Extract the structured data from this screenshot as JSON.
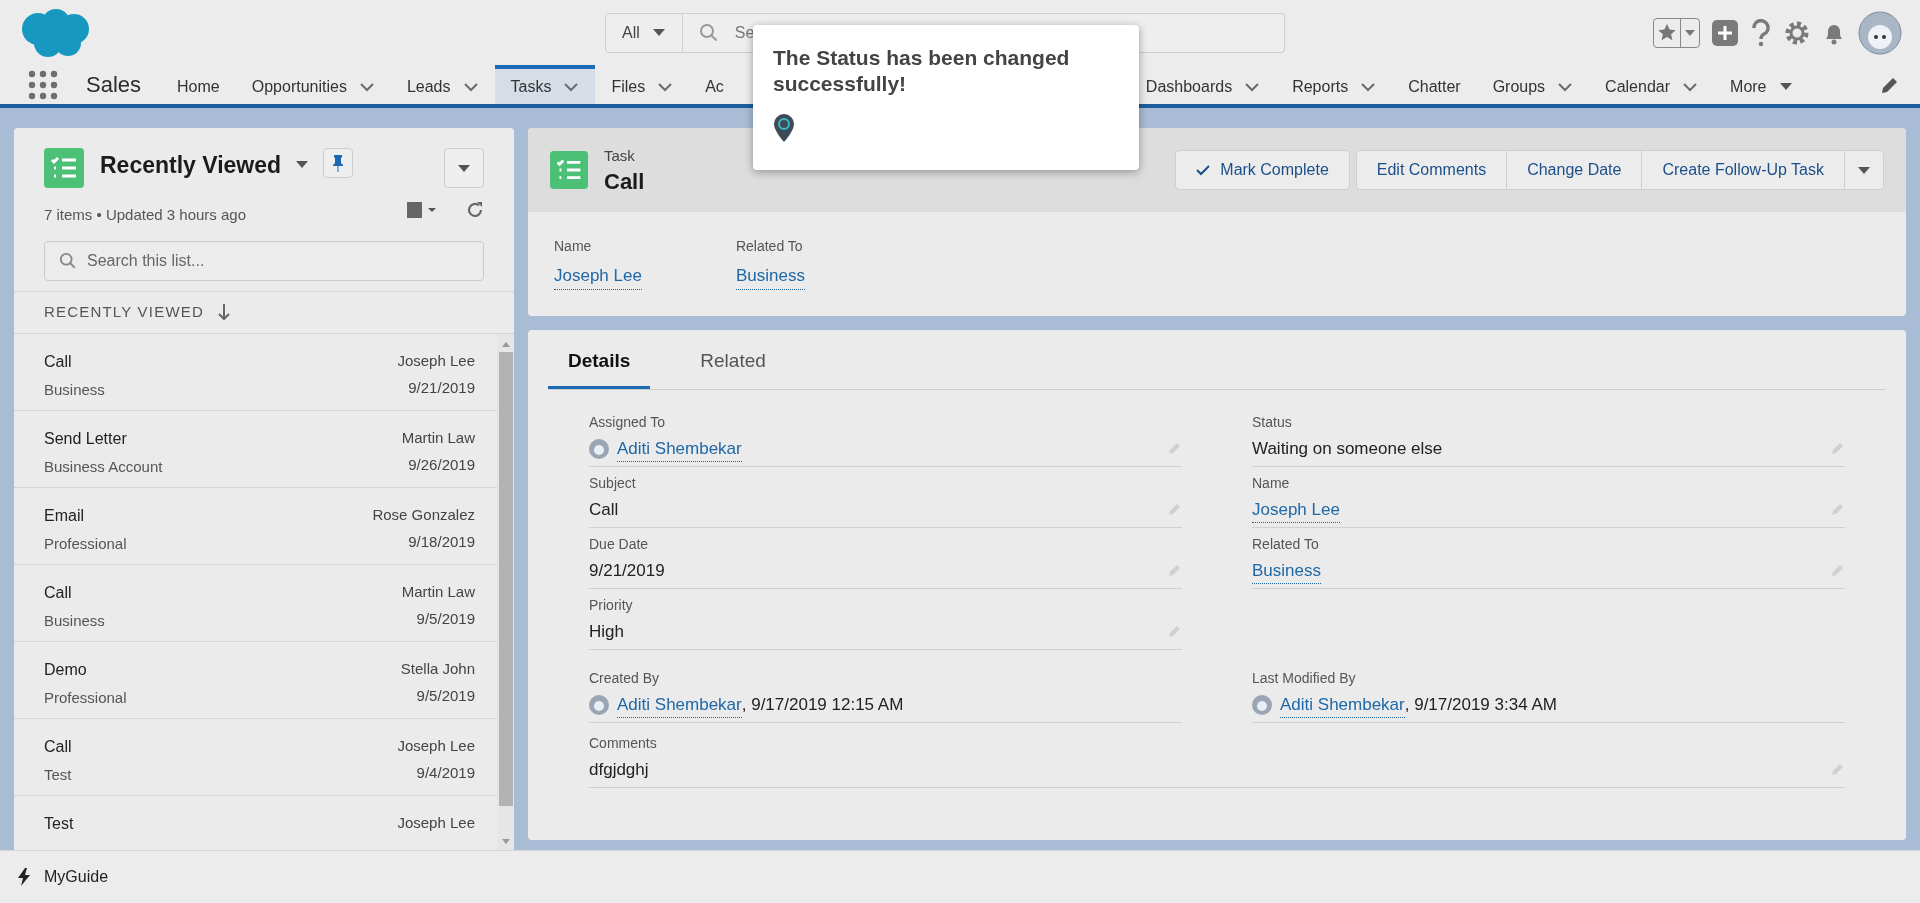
{
  "header": {
    "search_scope": "All",
    "search_placeholder": "Se"
  },
  "nav": {
    "app_name": "Sales",
    "items": [
      {
        "label": "Home",
        "kind": "plain",
        "selected": false
      },
      {
        "label": "Opportunities",
        "kind": "menu",
        "selected": false
      },
      {
        "label": "Leads",
        "kind": "menu",
        "selected": false
      },
      {
        "label": "Tasks",
        "kind": "menu",
        "selected": true
      },
      {
        "label": "Files",
        "kind": "menu",
        "selected": false
      },
      {
        "label": "Ac",
        "kind": "plain",
        "selected": false
      },
      {
        "label": "Dashboards",
        "kind": "menu",
        "selected": false
      },
      {
        "label": "Reports",
        "kind": "menu",
        "selected": false
      },
      {
        "label": "Chatter",
        "kind": "plain",
        "selected": false
      },
      {
        "label": "Groups",
        "kind": "menu",
        "selected": false
      },
      {
        "label": "Calendar",
        "kind": "menu",
        "selected": false
      },
      {
        "label": "More",
        "kind": "more",
        "selected": false
      }
    ]
  },
  "toast": {
    "message": "The Status has been changed successfully!"
  },
  "list": {
    "title": "Recently Viewed",
    "meta": "7 items • Updated 3 hours ago",
    "search_placeholder": "Search this list...",
    "column": "RECENTLY VIEWED",
    "rows": [
      {
        "title": "Call",
        "subtitle": "Business",
        "owner": "Joseph Lee",
        "date": "9/21/2019"
      },
      {
        "title": "Send Letter",
        "subtitle": "Business Account",
        "owner": "Martin Law",
        "date": "9/26/2019"
      },
      {
        "title": "Email",
        "subtitle": "Professional",
        "owner": "Rose Gonzalez",
        "date": "9/18/2019"
      },
      {
        "title": "Call",
        "subtitle": "Business",
        "owner": "Martin Law",
        "date": "9/5/2019"
      },
      {
        "title": "Demo",
        "subtitle": "Professional",
        "owner": "Stella John",
        "date": "9/5/2019"
      },
      {
        "title": "Call",
        "subtitle": "Test",
        "owner": "Joseph Lee",
        "date": "9/4/2019"
      },
      {
        "title": "Test",
        "owner": "Joseph Lee"
      }
    ]
  },
  "record": {
    "object_label": "Task",
    "title": "Call",
    "actions": [
      {
        "label": "Mark Complete",
        "kind": "check"
      },
      {
        "label": "Edit Comments",
        "kind": "plain"
      },
      {
        "label": "Change Date",
        "kind": "plain"
      },
      {
        "label": "Create Follow-Up Task",
        "kind": "plain"
      }
    ],
    "highlights": [
      {
        "label": "Name",
        "value": "Joseph Lee"
      },
      {
        "label": "Related To",
        "value": "Business"
      }
    ],
    "tabs": [
      {
        "label": "Details",
        "selected": true
      },
      {
        "label": "Related",
        "selected": false
      }
    ],
    "fields_left": [
      {
        "label": "Assigned To",
        "kind": "user",
        "value": "Aditi Shembekar"
      },
      {
        "label": "Subject",
        "kind": "text",
        "value": "Call"
      },
      {
        "label": "Due Date",
        "kind": "text",
        "value": "9/21/2019"
      },
      {
        "label": "Priority",
        "kind": "text",
        "value": "High"
      }
    ],
    "fields_right": [
      {
        "label": "Status",
        "kind": "text",
        "value": "Waiting on someone else"
      },
      {
        "label": "Name",
        "kind": "link",
        "value": "Joseph Lee"
      },
      {
        "label": "Related To",
        "kind": "link",
        "value": "Business"
      }
    ],
    "system_fields": [
      {
        "label": "Created By",
        "kind": "user",
        "value": "Aditi Shembekar",
        "suffix": ", 9/17/2019 12:15 AM"
      },
      {
        "label": "Last Modified By",
        "kind": "user",
        "value": "Aditi Shembekar",
        "suffix": ", 9/17/2019 3:34 AM"
      }
    ],
    "comments": {
      "label": "Comments",
      "value": "dfgjdghj"
    }
  },
  "footer": {
    "label": "MyGuide"
  }
}
